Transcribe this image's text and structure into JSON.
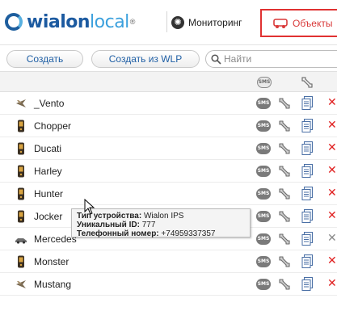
{
  "header": {
    "logo": {
      "part1": "wialon",
      "part2": "local",
      "mark": "®"
    },
    "nav": [
      {
        "label": "Мониторинг",
        "icon": "globe-icon"
      },
      {
        "label": "Объекты",
        "icon": "car-icon",
        "active": true
      }
    ]
  },
  "toolbar": {
    "create_label": "Создать",
    "create_wlp_label": "Создать из WLP",
    "search": {
      "placeholder": "Найти",
      "value": ""
    }
  },
  "columns": {
    "sms": "SMS",
    "properties_icon": "wrench-icon"
  },
  "objects": [
    {
      "name": "_Vento",
      "icon": "plane-icon",
      "sms": "SMS",
      "delete_enabled": true
    },
    {
      "name": "Chopper",
      "icon": "phone-icon",
      "sms": "SMS",
      "delete_enabled": true
    },
    {
      "name": "Ducati",
      "icon": "phone-icon",
      "sms": "SMS",
      "delete_enabled": true
    },
    {
      "name": "Harley",
      "icon": "phone-icon",
      "sms": "SMS",
      "delete_enabled": true
    },
    {
      "name": "Hunter",
      "icon": "phone-icon",
      "sms": "SMS",
      "delete_enabled": true
    },
    {
      "name": "Jocker",
      "icon": "phone-icon",
      "sms": "SMS",
      "delete_enabled": true
    },
    {
      "name": "Mercedes",
      "icon": "car-icon",
      "sms": "SMS",
      "delete_enabled": false
    },
    {
      "name": "Monster",
      "icon": "phone-icon",
      "sms": "SMS",
      "delete_enabled": true
    },
    {
      "name": "Mustang",
      "icon": "plane-icon",
      "sms": "SMS",
      "delete_enabled": true
    }
  ],
  "tooltip": {
    "device_type_label": "Тип устройства:",
    "device_type_value": "Wialon IPS",
    "uid_label": "Уникальный ID:",
    "uid_value": "777",
    "phone_label": "Телефонный номер:",
    "phone_value": "+74959337357"
  },
  "delete_glyph": "✕",
  "colors": {
    "brand_dark": "#1c5aa0",
    "brand_light": "#3ba0dd",
    "active_tab": "#e03131",
    "delete": "#e02020"
  }
}
